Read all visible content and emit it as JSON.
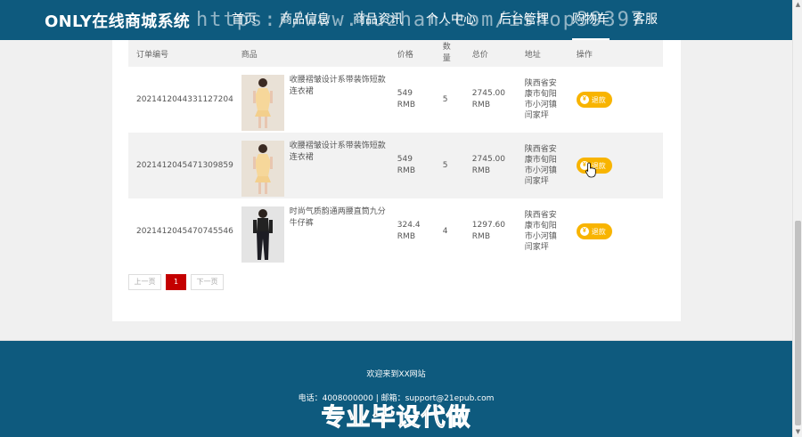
{
  "header": {
    "brand": "ONLY在线商城系统",
    "nav": [
      "首页",
      "商品信息",
      "商品资讯",
      "个人中心",
      "后台管理",
      "购物车",
      "客服"
    ],
    "active_index": 5,
    "watermark": "https://www.huzhan.com/ishop39397"
  },
  "table": {
    "columns": [
      "订单编号",
      "商品",
      "价格",
      "数量",
      "总价",
      "地址",
      "操作"
    ],
    "rows": [
      {
        "order_id": "2021412044331127204",
        "product": "收腰褶皱设计系带装饰短款连衣裙",
        "price": "549 RMB",
        "qty": "5",
        "total": "2745.00 RMB",
        "address": "陕西省安康市旬阳市小河镇闫家坪",
        "action": "退款"
      },
      {
        "order_id": "2021412045471309859",
        "product": "收腰褶皱设计系带装饰短款连衣裙",
        "price": "549 RMB",
        "qty": "5",
        "total": "2745.00 RMB",
        "address": "陕西省安康市旬阳市小河镇闫家坪",
        "action": "退款"
      },
      {
        "order_id": "2021412045470745546",
        "product": "时尚气质韵通两腰直筒九分牛仔裤",
        "price": "324.4 RMB",
        "qty": "4",
        "total": "1297.60 RMB",
        "address": "陕西省安康市旬阳市小河镇闫家坪",
        "action": "退款"
      }
    ]
  },
  "pagination": {
    "prev": "上一页",
    "current": "1",
    "next": "下一页"
  },
  "footer": {
    "welcome": "欢迎来到XX网站",
    "contact": "电话：4008000000 | 邮箱：support@21epub.com",
    "watermark": "专业毕设代做"
  },
  "colors": {
    "header_bg": "#0e5a7e",
    "refund_button": "#f8b400",
    "page_current": "#c40000"
  }
}
